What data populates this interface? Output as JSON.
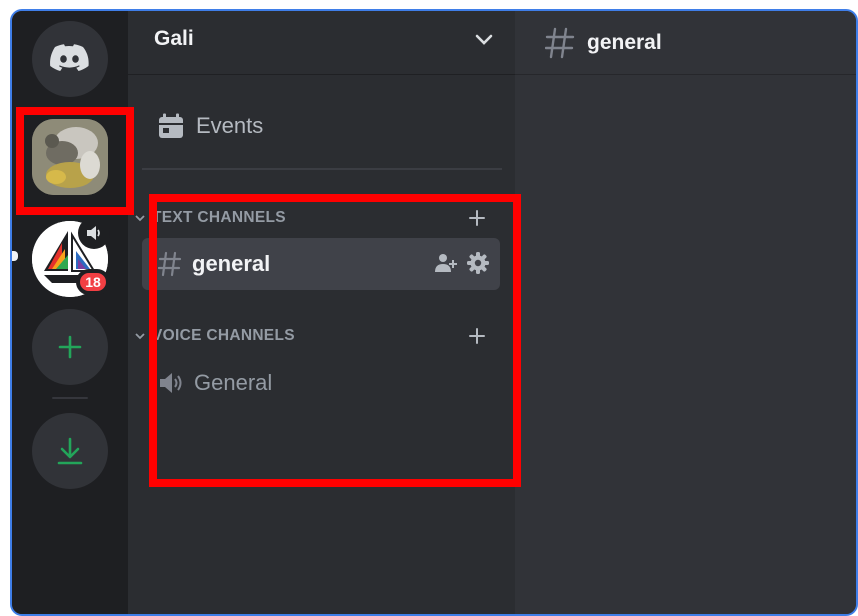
{
  "server": {
    "name": "Gali",
    "badge_count": "18"
  },
  "events": {
    "label": "Events"
  },
  "categories": {
    "text": {
      "label": "TEXT CHANNELS"
    },
    "voice": {
      "label": "VOICE CHANNELS"
    }
  },
  "channels": {
    "text_active": "general",
    "voice": "General"
  },
  "chat": {
    "title": "general"
  },
  "colors": {
    "rail_bg": "#1e1f22",
    "sidebar_bg": "#2b2d31",
    "chat_bg": "#313338",
    "active_row": "#404249",
    "accent_green": "#23a55a",
    "mention_red": "#f23f43",
    "highlight_red": "#ff0000"
  },
  "icons": {
    "home": "discord-logo-icon",
    "events": "calendar-icon",
    "chevron": "chevron-down-icon",
    "text_channel": "hash-icon",
    "voice_channel": "speaker-icon",
    "add": "plus-icon",
    "download": "download-icon",
    "invite": "add-member-icon",
    "settings": "gear-icon"
  }
}
